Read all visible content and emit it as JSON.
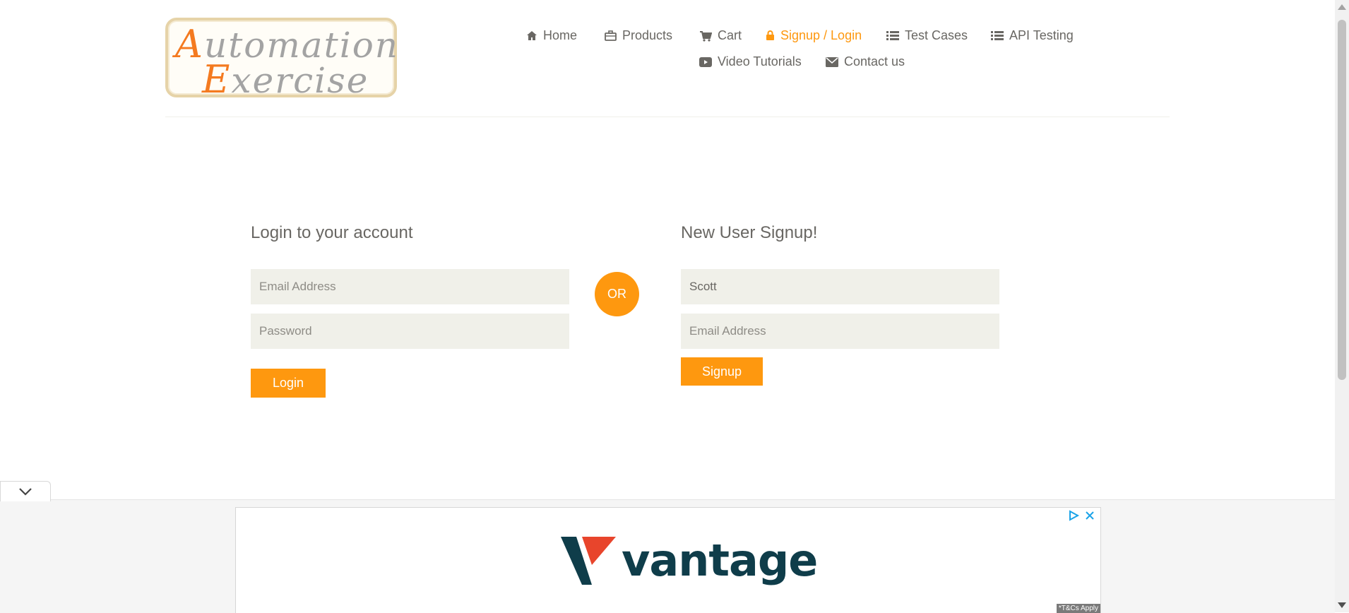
{
  "brand": {
    "logo_line1_cap": "A",
    "logo_line1_rest": "utomation",
    "logo_line2_cap": "E",
    "logo_line2_rest": "xercise"
  },
  "nav": {
    "home": "Home",
    "products": "Products",
    "cart": "Cart",
    "signup_login": "Signup / Login",
    "test_cases": "Test Cases",
    "api_testing": "API Testing",
    "video_tutorials": "Video Tutorials",
    "contact_us": "Contact us"
  },
  "login": {
    "title": "Login to your account",
    "email_placeholder": "Email Address",
    "password_placeholder": "Password",
    "button": "Login"
  },
  "divider": "OR",
  "signup": {
    "title": "New User Signup!",
    "name_value": "Scott",
    "email_placeholder": "Email Address",
    "button": "Signup"
  },
  "ad": {
    "brand": "vantage",
    "terms": "*T&Cs Apply"
  },
  "colors": {
    "accent": "#fe980f",
    "text": "#696763",
    "field_bg": "#f0f0e9",
    "ad_brand": "#0f3d4a",
    "ad_red": "#e8452c"
  }
}
